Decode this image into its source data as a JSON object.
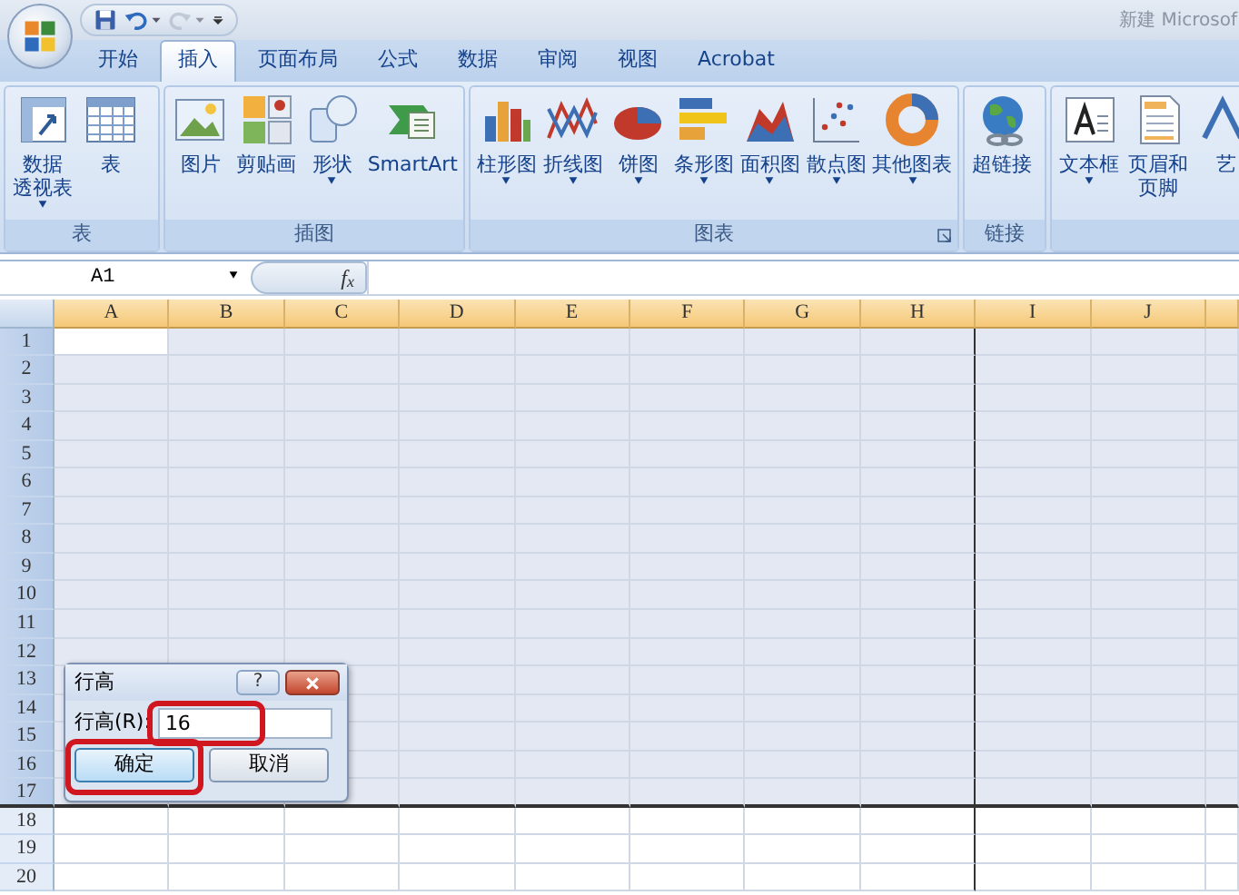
{
  "title_bar": {
    "title": "新建 Microsof",
    "quick_access": [
      {
        "kind": "save",
        "dropdown": false,
        "disabled": false
      },
      {
        "kind": "undo",
        "dropdown": true,
        "disabled": false
      },
      {
        "kind": "redo",
        "dropdown": true,
        "disabled": true
      },
      {
        "kind": "customize",
        "dropdown": false,
        "disabled": false
      }
    ]
  },
  "tabs": [
    {
      "label": "开始",
      "selected": false
    },
    {
      "label": "插入",
      "selected": true
    },
    {
      "label": "页面布局",
      "selected": false
    },
    {
      "label": "公式",
      "selected": false
    },
    {
      "label": "数据",
      "selected": false
    },
    {
      "label": "审阅",
      "selected": false
    },
    {
      "label": "视图",
      "selected": false
    },
    {
      "label": "Acrobat",
      "selected": false
    }
  ],
  "ribbon_groups": [
    {
      "label": "表",
      "launcher": false,
      "commands": [
        {
          "kind": "pivot",
          "label_lines": [
            "数据",
            "透视表"
          ],
          "dropdown": true
        },
        {
          "kind": "table",
          "label": "表",
          "dropdown": false
        }
      ]
    },
    {
      "label": "插图",
      "launcher": false,
      "commands": [
        {
          "kind": "picture",
          "label": "图片",
          "dropdown": false
        },
        {
          "kind": "clipart",
          "label": "剪贴画",
          "dropdown": false
        },
        {
          "kind": "shapes",
          "label": "形状",
          "dropdown": true
        },
        {
          "kind": "smartart",
          "label": "SmartArt",
          "dropdown": false
        }
      ]
    },
    {
      "label": "图表",
      "launcher": true,
      "commands": [
        {
          "kind": "column",
          "label": "柱形图",
          "dropdown": true
        },
        {
          "kind": "line",
          "label": "折线图",
          "dropdown": true
        },
        {
          "kind": "pie",
          "label": "饼图",
          "dropdown": true
        },
        {
          "kind": "bar",
          "label": "条形图",
          "dropdown": true
        },
        {
          "kind": "area",
          "label": "面积图",
          "dropdown": true
        },
        {
          "kind": "scatter",
          "label": "散点图",
          "dropdown": true
        },
        {
          "kind": "other",
          "label": "其他图表",
          "dropdown": true
        }
      ]
    },
    {
      "label": "链接",
      "launcher": false,
      "commands": [
        {
          "kind": "hyperlink",
          "label": "超链接",
          "dropdown": false
        }
      ]
    },
    {
      "commands": [
        {
          "kind": "textbox",
          "label": "文本框",
          "dropdown": true
        },
        {
          "kind": "header",
          "label_lines": [
            "页眉和",
            "页脚"
          ],
          "dropdown": false
        },
        {
          "kind": "wordart",
          "label": "艺",
          "dropdown": false
        }
      ]
    }
  ],
  "formula_bar": {
    "name_box": "A1",
    "function_label": "f$_{x}$"
  },
  "sheet": {
    "columns": [
      {
        "label": "A",
        "page_break_after": false
      },
      {
        "label": "B",
        "page_break_after": false
      },
      {
        "label": "C",
        "page_break_after": false
      },
      {
        "label": "D",
        "page_break_after": false
      },
      {
        "label": "E",
        "page_break_after": false
      },
      {
        "label": "F",
        "page_break_after": false
      },
      {
        "label": "G",
        "page_break_after": false
      },
      {
        "label": "H",
        "page_break_after": true
      },
      {
        "label": "I",
        "page_break_after": false
      },
      {
        "label": "J",
        "page_break_after": false
      }
    ],
    "rows": [
      {
        "label": "1",
        "selected": true,
        "active": true
      },
      {
        "label": "2",
        "selected": true,
        "active": false
      },
      {
        "label": "3",
        "selected": true,
        "active": false
      },
      {
        "label": "4",
        "selected": true,
        "active": false
      },
      {
        "label": "5",
        "selected": true,
        "active": false
      },
      {
        "label": "6",
        "selected": true,
        "active": false
      },
      {
        "label": "7",
        "selected": true,
        "active": false
      },
      {
        "label": "8",
        "selected": true,
        "active": false
      },
      {
        "label": "9",
        "selected": true,
        "active": false
      },
      {
        "label": "10",
        "selected": true,
        "active": false
      },
      {
        "label": "11",
        "selected": true,
        "active": false
      },
      {
        "label": "12",
        "selected": true,
        "active": false
      },
      {
        "label": "13",
        "selected": true,
        "active": false
      },
      {
        "label": "14",
        "selected": true,
        "active": false
      },
      {
        "label": "15",
        "selected": true,
        "active": false
      },
      {
        "label": "16",
        "selected": true,
        "active": false
      },
      {
        "label": "17",
        "selected": true,
        "active": false
      },
      {
        "label": "18",
        "selected": false,
        "active": false
      },
      {
        "label": "19",
        "selected": false,
        "active": false
      },
      {
        "label": "20",
        "selected": false,
        "active": false
      }
    ]
  },
  "dialog": {
    "title": "行高",
    "help": "?",
    "field_label": "行高(R):",
    "field_value": "16",
    "field_highlighted": true,
    "buttons": [
      {
        "label": "确定",
        "default": true,
        "highlighted": true
      },
      {
        "label": "取消",
        "default": false,
        "highlighted": false
      }
    ]
  }
}
